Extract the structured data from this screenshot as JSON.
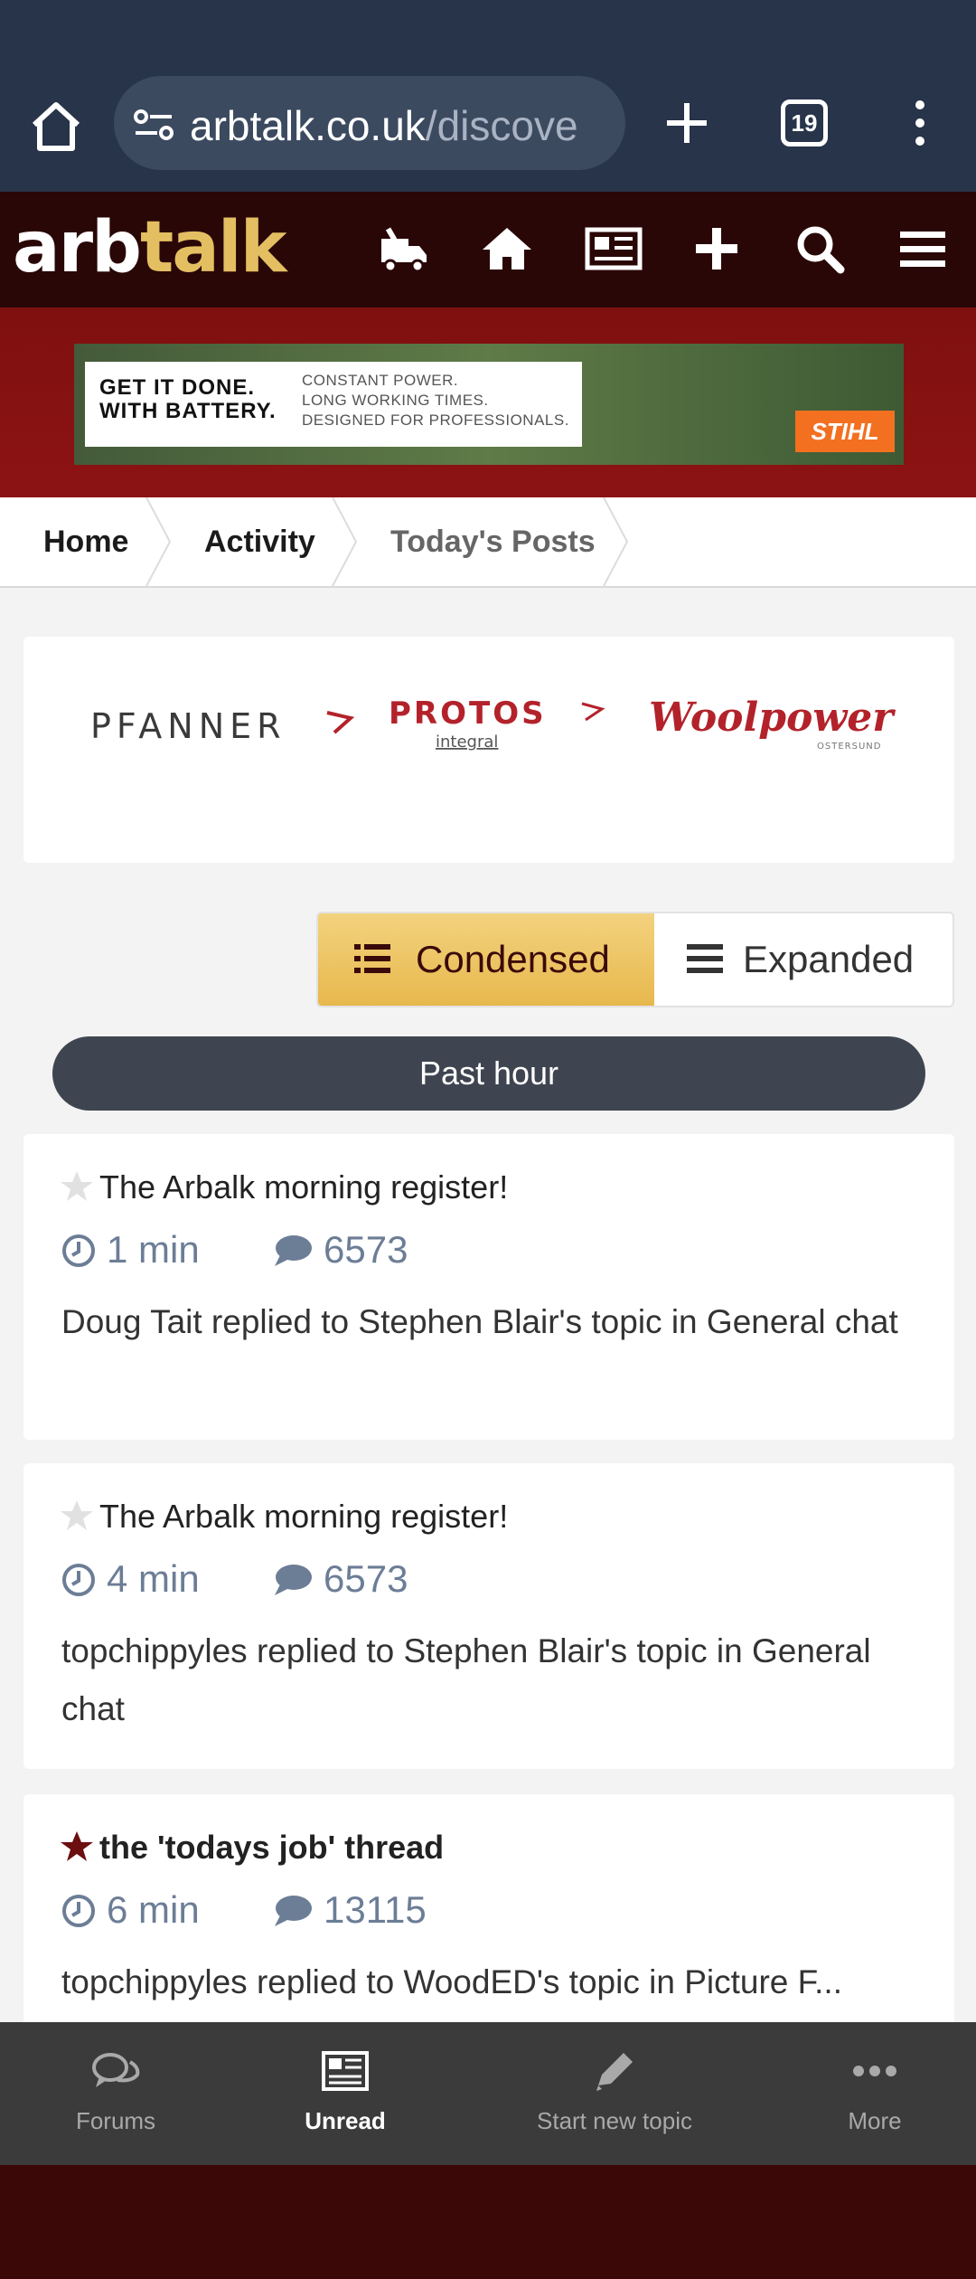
{
  "browser": {
    "url_host": "arbtalk.co.uk",
    "url_path": "/discove",
    "tab_count": "19"
  },
  "site": {
    "logo_part1": "arb",
    "logo_part2": "talk"
  },
  "ad": {
    "headline_line1": "GET IT DONE.",
    "headline_line2": "WITH BATTERY.",
    "sub_line1": "CONSTANT POWER.",
    "sub_line2": "LONG WORKING TIMES.",
    "sub_line3": "DESIGNED FOR PROFESSIONALS.",
    "brand": "STIHL"
  },
  "breadcrumb": {
    "items": [
      {
        "label": "Home"
      },
      {
        "label": "Activity"
      },
      {
        "label": "Today's Posts"
      }
    ]
  },
  "partners": [
    {
      "name": "PFANNER",
      "color": "#3a3a3a"
    },
    {
      "name": "PROTOS",
      "sub": "integral",
      "color": "#b3222a"
    },
    {
      "name": "Woolpower",
      "sub": "OSTERSUND",
      "color": "#b3222a"
    }
  ],
  "view_toggle": {
    "condensed_label": "Condensed",
    "expanded_label": "Expanded",
    "selected": "Condensed"
  },
  "time_filter": {
    "label": "Past hour"
  },
  "activity": [
    {
      "title": "The Arbalk morning register!",
      "followed": false,
      "time": "1 min",
      "replies": "6573",
      "description": "Doug Tait replied to Stephen Blair's topic in General chat"
    },
    {
      "title": "The Arbalk morning register!",
      "followed": false,
      "time": "4 min",
      "replies": "6573",
      "description": "topchippyles replied to Stephen Blair's topic in General chat"
    },
    {
      "title": "the 'todays job' thread",
      "followed": true,
      "time": "6 min",
      "replies": "13115",
      "description": "topchippyles replied to WoodED's topic in Picture F..."
    }
  ],
  "bottom_nav": {
    "items": [
      {
        "label": "Forums",
        "icon": "chat-bubbles-icon"
      },
      {
        "label": "Unread",
        "icon": "newspaper-icon",
        "active": true
      },
      {
        "label": "Start new topic",
        "icon": "pencil-icon"
      },
      {
        "label": "More",
        "icon": "ellipsis-icon"
      }
    ]
  },
  "colors": {
    "browser_bar": "#27344a",
    "header": "#2a0707",
    "ad_band": "#8d1313",
    "accent_gold": "#e7b84d",
    "meta_blue": "#6c7d96",
    "star_active": "#6b0f0f"
  }
}
